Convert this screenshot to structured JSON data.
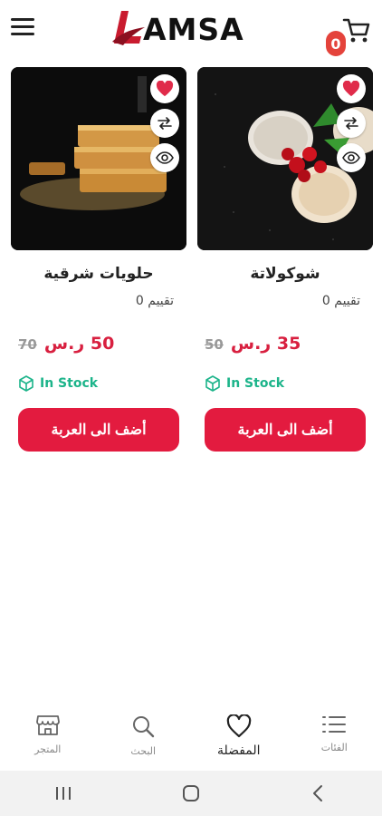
{
  "header": {
    "logo_text": "AMSA",
    "cart_count": "0"
  },
  "products": [
    {
      "title": "شوكولاتة",
      "rating": "تقييم 0",
      "price_new": "35 ر.س",
      "price_old": "50",
      "stock": "In Stock",
      "add_label": "أضف الى العربة"
    },
    {
      "title": "حلويات شرقية",
      "rating": "تقييم 0",
      "price_new": "50 ر.س",
      "price_old": "70",
      "stock": "In Stock",
      "add_label": "أضف الى العربة"
    }
  ],
  "bottom_nav": [
    {
      "label": "الفئات",
      "icon": "list-icon"
    },
    {
      "label": "المفضلة",
      "icon": "heart-icon"
    },
    {
      "label": "البحث",
      "icon": "search-icon"
    },
    {
      "label": "المتجر",
      "icon": "store-icon"
    }
  ],
  "colors": {
    "accent": "#e31b3f",
    "heart": "#e02b4a",
    "stock": "#1cb48a",
    "badge": "#e4433b"
  }
}
